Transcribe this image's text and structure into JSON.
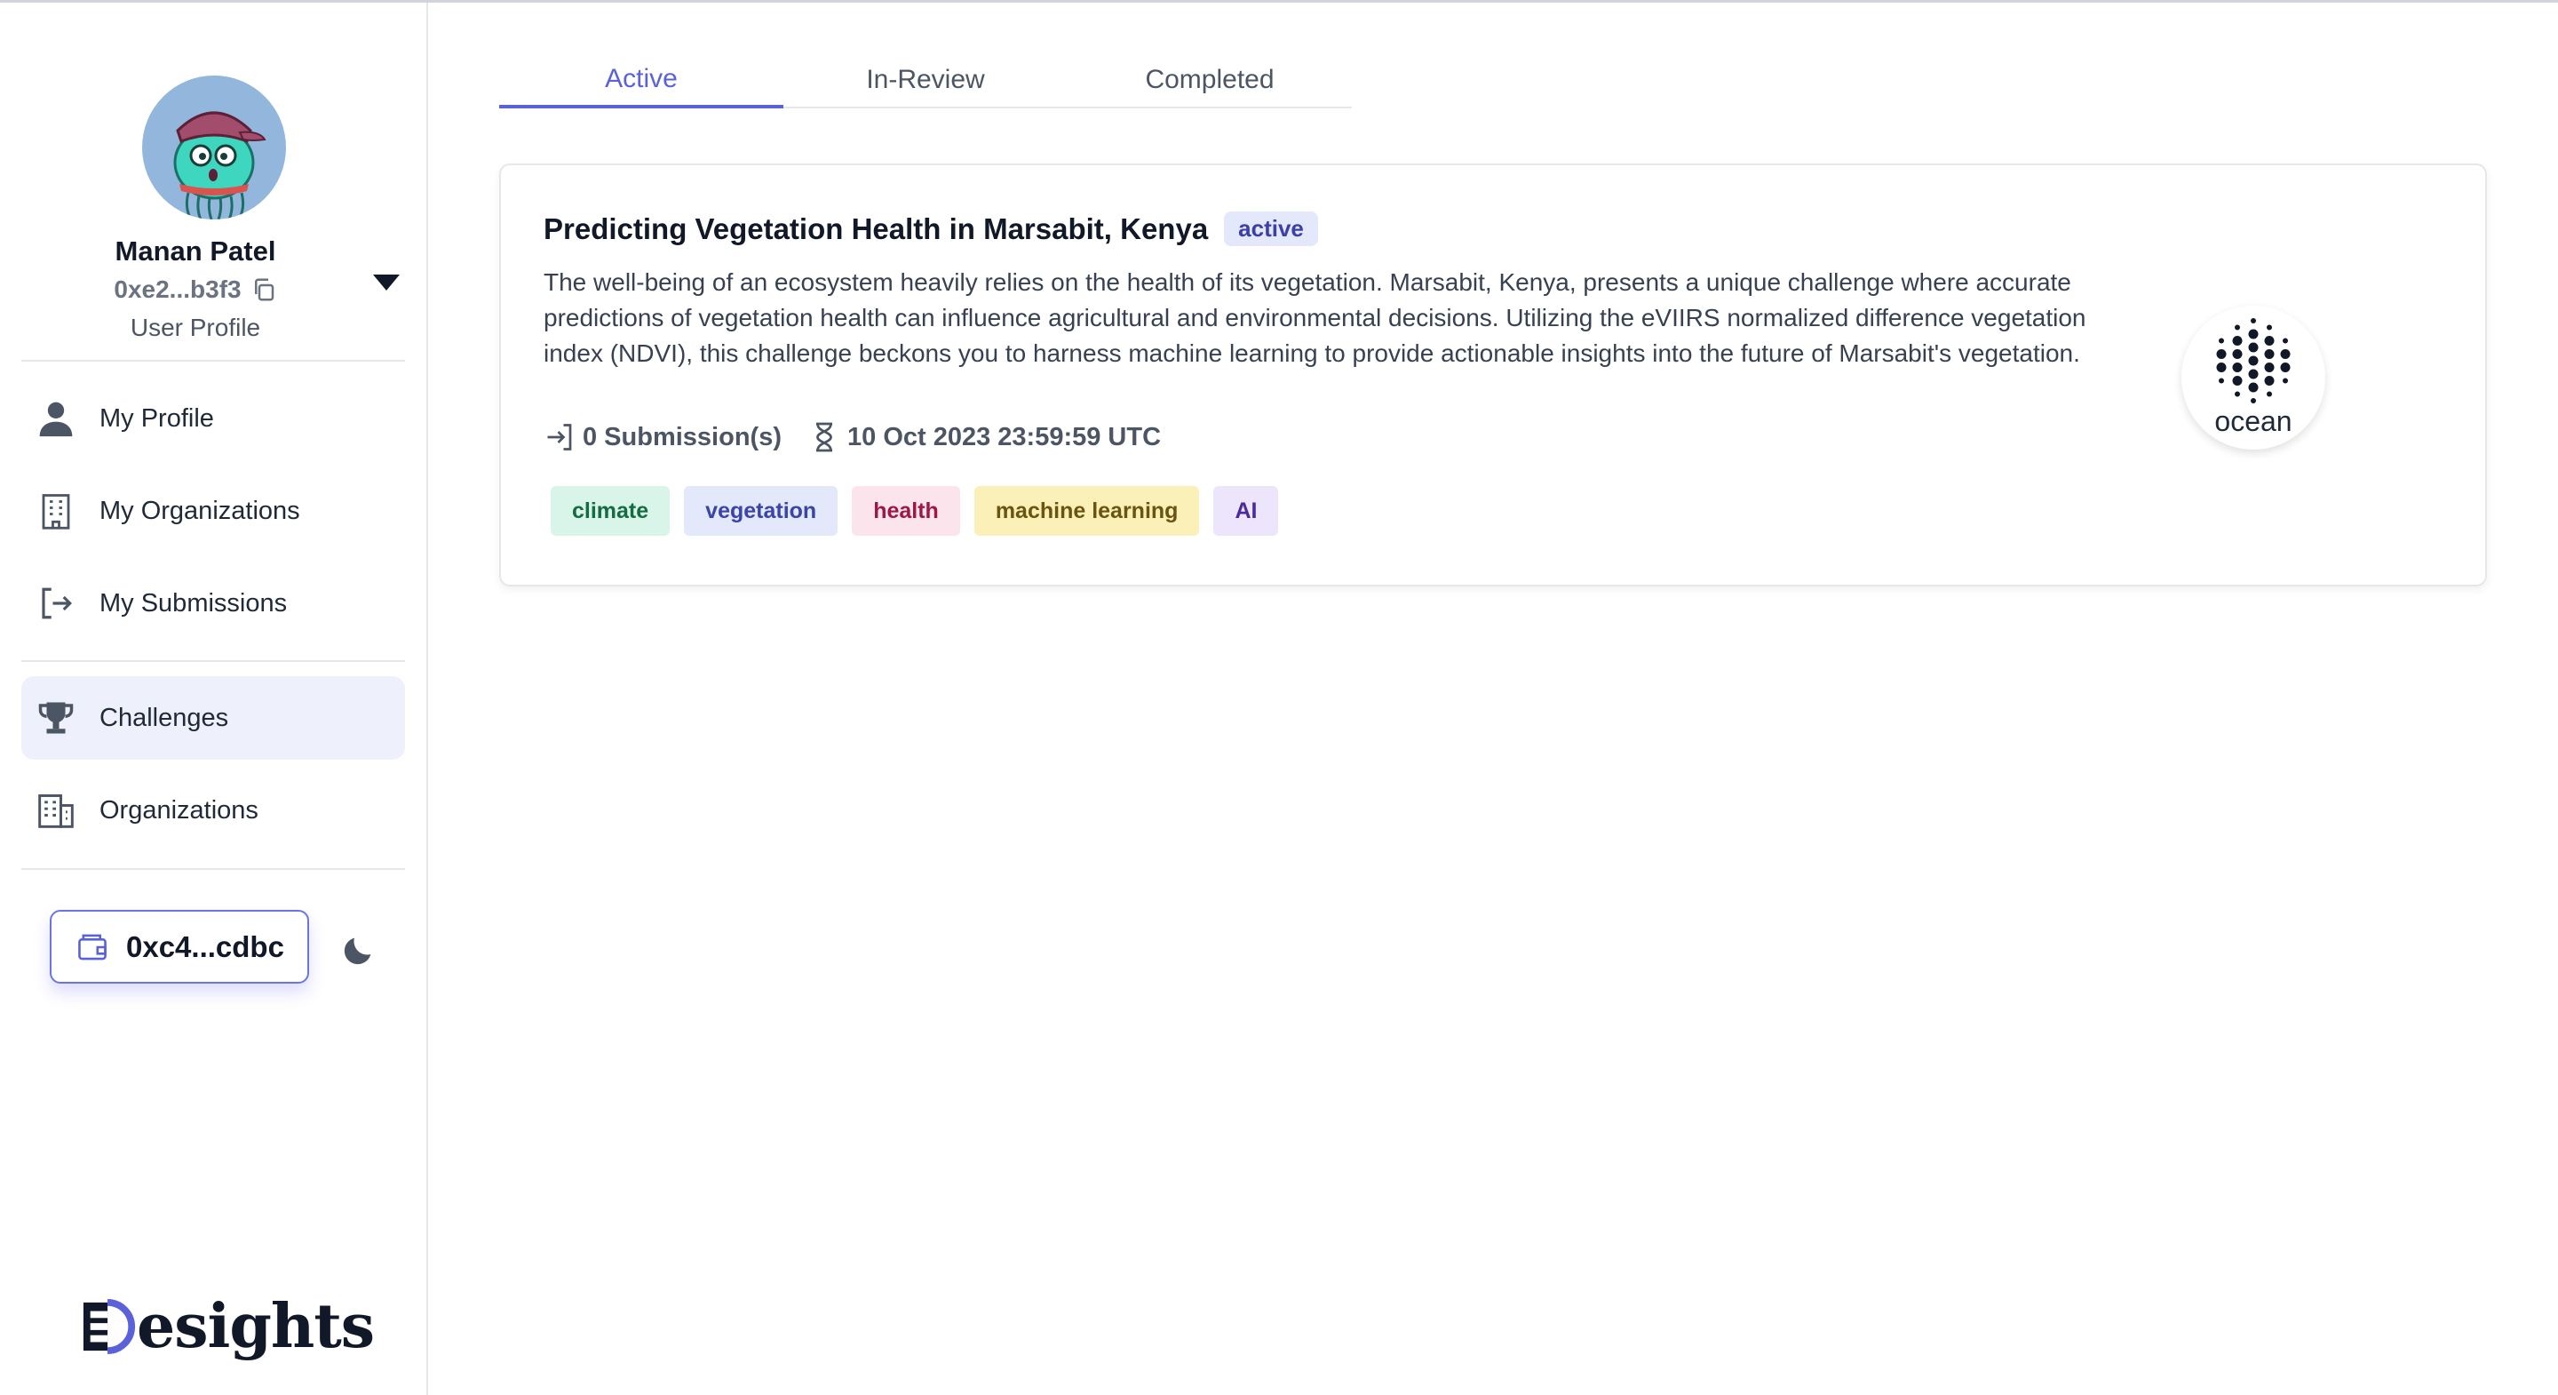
{
  "user": {
    "name": "Manan Patel",
    "address": "0xe2...b3f3",
    "role": "User Profile"
  },
  "sidebar": {
    "items": [
      {
        "label": "My Profile",
        "icon": "user-icon"
      },
      {
        "label": "My Organizations",
        "icon": "building-icon"
      },
      {
        "label": "My Submissions",
        "icon": "sign-out-icon"
      },
      {
        "label": "Challenges",
        "icon": "trophy-icon",
        "active": true
      },
      {
        "label": "Organizations",
        "icon": "office-building-icon"
      }
    ]
  },
  "wallet": {
    "label": "0xc4...cdbc"
  },
  "brand": {
    "name": "Desights"
  },
  "tabs": [
    {
      "label": "Active",
      "active": true
    },
    {
      "label": "In-Review"
    },
    {
      "label": "Completed"
    }
  ],
  "challenge": {
    "title": "Predicting Vegetation Health in Marsabit, Kenya",
    "status": "active",
    "description": "The well-being of an ecosystem heavily relies on the health of its vegetation. Marsabit, Kenya, presents a unique challenge where accurate predictions of vegetation health can influence agricultural and environmental decisions. Utilizing the eVIIRS normalized difference vegetation index (NDVI), this challenge beckons you to harness machine learning to provide actionable insights into the future of Marsabit's vegetation.",
    "submissions": "0 Submission(s)",
    "deadline": "10 Oct 2023 23:59:59 UTC",
    "org": "ocean",
    "tags": [
      {
        "label": "climate",
        "bg": "#d9f4e8",
        "fg": "#146c43"
      },
      {
        "label": "vegetation",
        "bg": "#e3e8fb",
        "fg": "#3b44a8"
      },
      {
        "label": "health",
        "bg": "#fce4ec",
        "fg": "#9d1747"
      },
      {
        "label": "machine learning",
        "bg": "#fbf1b8",
        "fg": "#6b5310"
      },
      {
        "label": "AI",
        "bg": "#ece5fb",
        "fg": "#4b2a99"
      }
    ]
  },
  "colors": {
    "accent": "#5b62d9",
    "active_nav_bg": "#eef0fb"
  }
}
